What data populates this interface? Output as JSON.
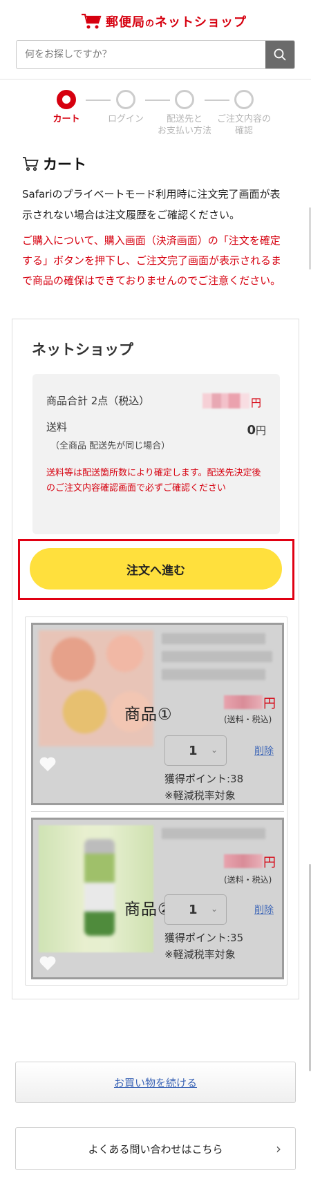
{
  "header": {
    "logo_main": "郵便局",
    "logo_mid": "の",
    "logo_tail": "ネットショップ",
    "logo_badge": "郵便局",
    "search_placeholder": "何をお探しですか？"
  },
  "steps": [
    {
      "label": "カート",
      "active": true
    },
    {
      "label": "ログイン",
      "active": false
    },
    {
      "label": "配送先と\nお支払い方法",
      "active": false
    },
    {
      "label": "ご注文内容の\n確認",
      "active": false
    }
  ],
  "cart": {
    "title": "カート",
    "notice": "Safariのプライベートモード利用時に注文完了画面が表示されない場合は注文履歴をご確認ください。",
    "warning": "ご購入について、購入画面（決済画面）の「注文を確定する」ボタンを押下し、ご注文完了画面が表示されるまで商品の確保はできておりませんのでご注意ください。"
  },
  "shop": {
    "title": "ネットショップ",
    "subtotal_label": "商品合計 2点（税込）",
    "subtotal_yen": "円",
    "shipping_label": "送料",
    "shipping_sub": "（全商品 配送先が同じ場合）",
    "shipping_value": "0",
    "shipping_yen": "円",
    "shipping_note": "送料等は配送箇所数により確定します。配送先決定後のご注文内容確認画面で必ずご確認ください",
    "proceed_label": "注文へ進む"
  },
  "items": [
    {
      "label": "商品①",
      "yen": "円",
      "tax": "(送料・税込)",
      "qty": "1",
      "delete": "削除",
      "points": "獲得ポイント:38",
      "reduced": "※軽減税率対象"
    },
    {
      "label": "商品②",
      "yen": "円",
      "tax": "(送料・税込)",
      "qty": "1",
      "delete": "削除",
      "points": "獲得ポイント:35",
      "reduced": "※軽減税率対象"
    }
  ],
  "footer": {
    "continue_label": "お買い物を続ける",
    "faq_label": "よくある問い合わせはこちら"
  },
  "colors": {
    "brand_red": "#d6000f",
    "button_yellow": "#ffe03d",
    "link_blue": "#3d66b7"
  }
}
